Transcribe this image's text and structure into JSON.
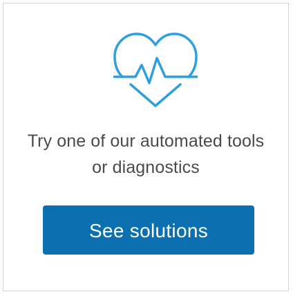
{
  "card": {
    "icon": "heart-pulse-icon",
    "message_lines": [
      "Try one of our automated tools",
      "or diagnostics"
    ],
    "button_label": "See solutions"
  },
  "colors": {
    "accent": "#0b6fb0",
    "icon": "#2d9fe0",
    "text": "#4a4a4a",
    "border": "#d4d4d4"
  }
}
